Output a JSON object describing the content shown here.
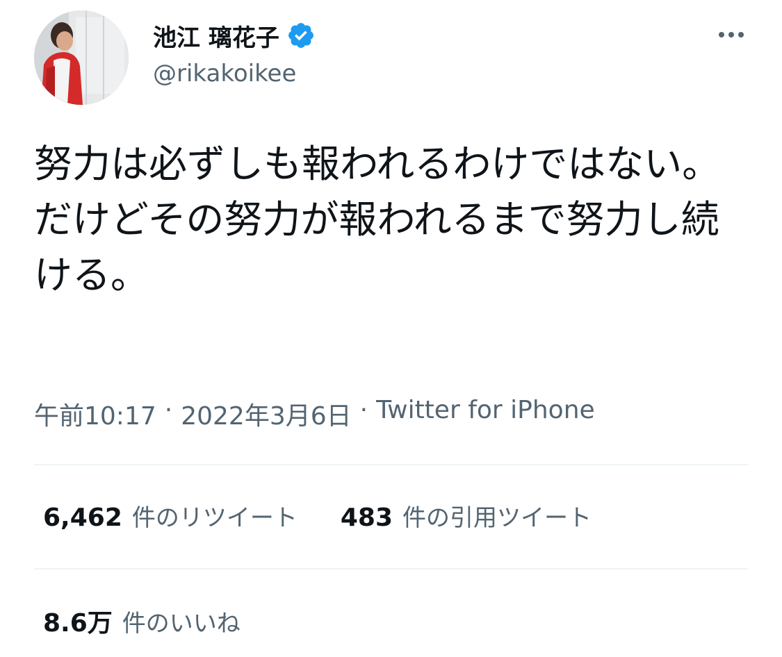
{
  "user": {
    "display_name": "池江 璃花子",
    "handle": "@rikakoikee",
    "verified": true,
    "avatar_icon": "profile-photo"
  },
  "tweet": {
    "text": "努力は必ずしも報われるわけではない。\nだけどその努力が報われるまで努力し続ける。",
    "time": "午前10:17",
    "date": "2022年3月6日",
    "separator": "·",
    "source": "Twitter for iPhone"
  },
  "stats": {
    "retweets": {
      "count": "6,462",
      "label": "件のリツイート"
    },
    "quotes": {
      "count": "483",
      "label": "件の引用ツイート"
    },
    "likes": {
      "count": "8.6万",
      "label": "件のいいね"
    }
  },
  "colors": {
    "text_primary": "#0f1419",
    "text_secondary": "#536471",
    "verified_blue": "#1d9bf0",
    "divider": "#eff3f4"
  },
  "icons": {
    "more": "more-horizontal-icon",
    "verified": "verified-badge-icon"
  }
}
